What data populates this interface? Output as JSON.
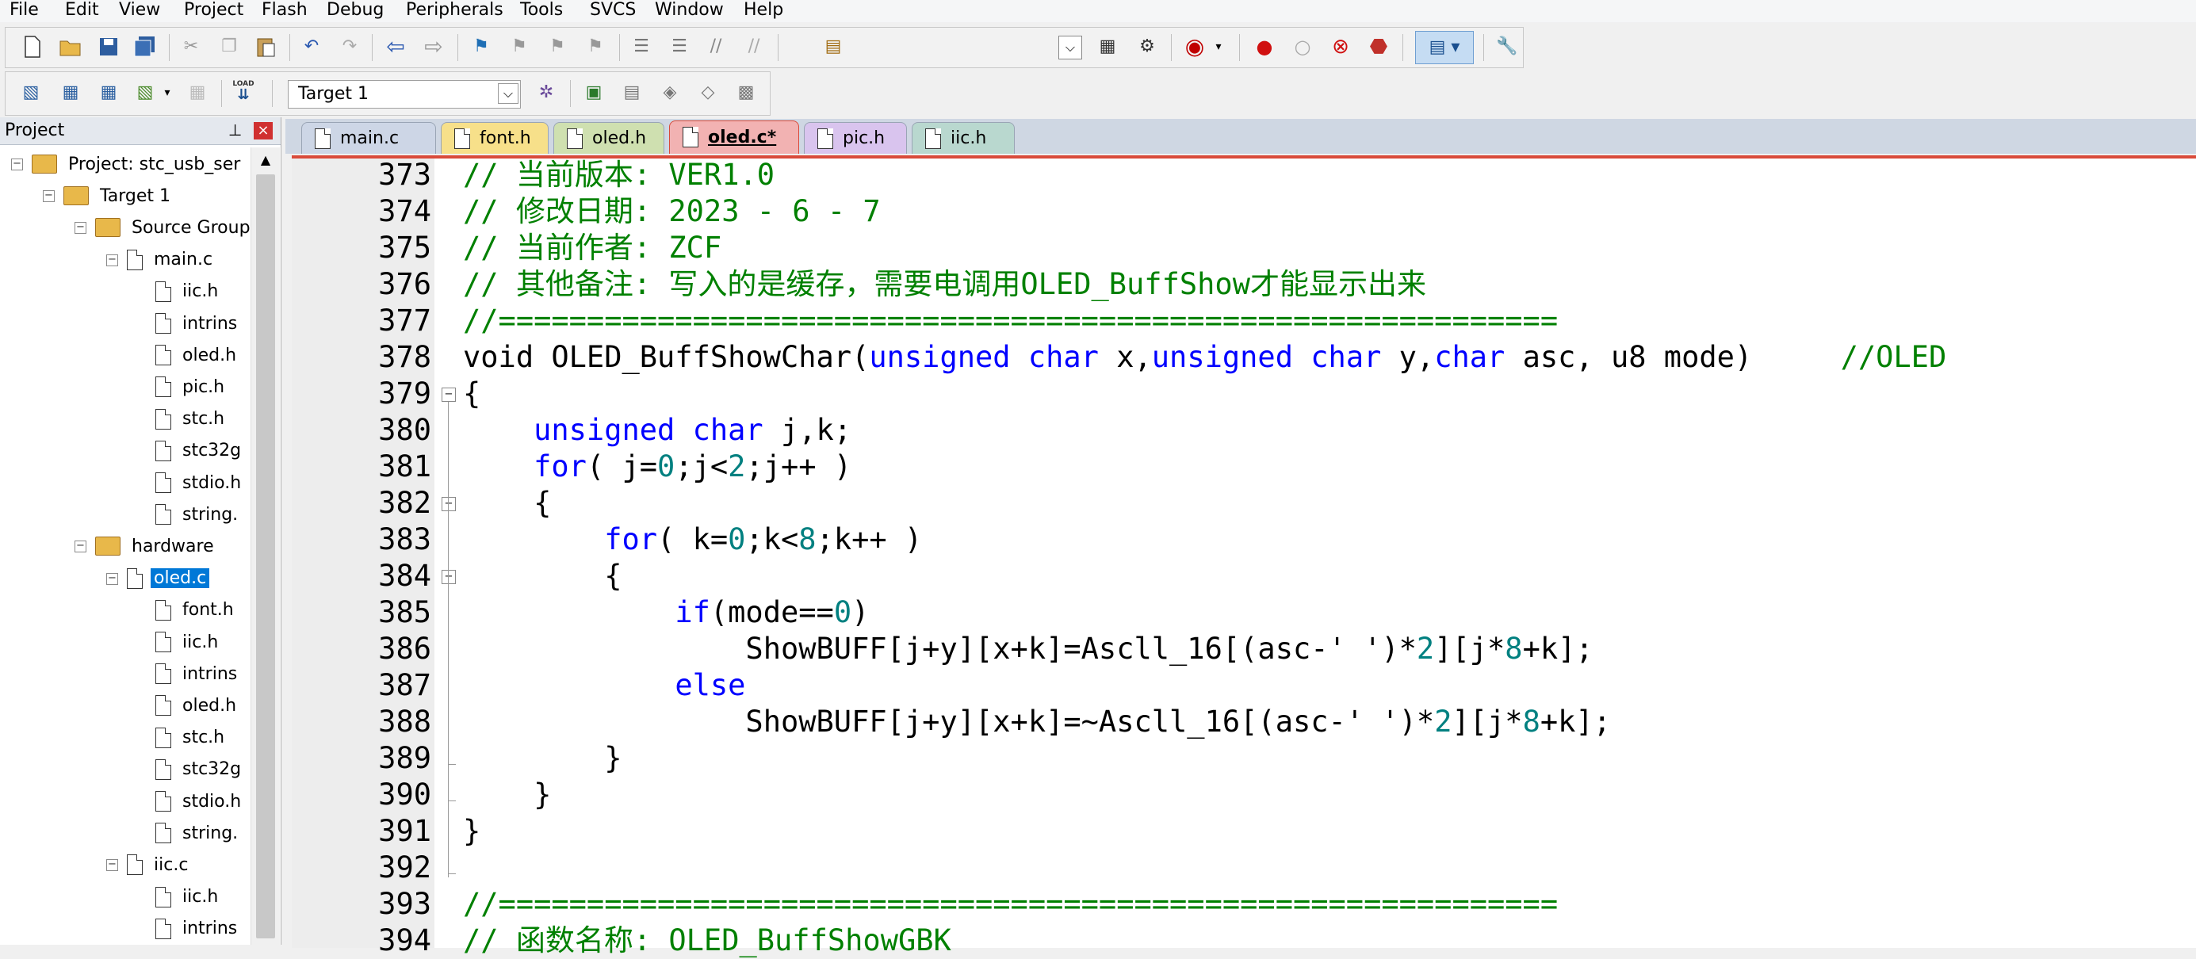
{
  "menu": [
    "File",
    "Edit",
    "View",
    "Project",
    "Flash",
    "Debug",
    "Peripherals",
    "Tools",
    "SVCS",
    "Window",
    "Help"
  ],
  "toolbar": {
    "icons": [
      "new-file-icon",
      "open-icon",
      "save-icon",
      "save-all-icon",
      "cut-icon",
      "copy-icon",
      "paste-icon",
      "undo-icon",
      "redo-icon",
      "nav-back-icon",
      "nav-forward-icon",
      "bookmark-icon",
      "prev-bookmark-icon",
      "next-bookmark-icon",
      "clear-bookmarks-icon",
      "indent-icon",
      "unindent-icon",
      "comment-icon",
      "uncomment-icon",
      "find-in-files-icon",
      "find-icon",
      "incremental-find-icon",
      "debug-session-icon",
      "breakpoint-icon",
      "disable-breakpoint-icon",
      "kill-breakpoints-icon",
      "clear-breakpoints-icon",
      "window-layout-icon",
      "configure-icon"
    ]
  },
  "build_toolbar": {
    "target": "Target 1",
    "load_label": "LOAD"
  },
  "project_panel": {
    "title": "Project",
    "pin": "ᵖ",
    "close": "×",
    "tree": [
      {
        "label": "Project: stc_usb_ser",
        "level": 0,
        "type": "project"
      },
      {
        "label": "Target 1",
        "level": 1,
        "type": "folder"
      },
      {
        "label": "Source Group",
        "level": 2,
        "type": "folder"
      },
      {
        "label": "main.c",
        "level": 3,
        "type": "file"
      },
      {
        "label": "iic.h",
        "level": 4,
        "type": "file"
      },
      {
        "label": "intrins",
        "level": 4,
        "type": "file"
      },
      {
        "label": "oled.h",
        "level": 4,
        "type": "file"
      },
      {
        "label": "pic.h",
        "level": 4,
        "type": "file"
      },
      {
        "label": "stc.h",
        "level": 4,
        "type": "file"
      },
      {
        "label": "stc32g",
        "level": 4,
        "type": "file"
      },
      {
        "label": "stdio.h",
        "level": 4,
        "type": "file"
      },
      {
        "label": "string.",
        "level": 4,
        "type": "file"
      },
      {
        "label": "hardware",
        "level": 2,
        "type": "folder"
      },
      {
        "label": "oled.c",
        "level": 3,
        "type": "file",
        "selected": true
      },
      {
        "label": "font.h",
        "level": 4,
        "type": "file"
      },
      {
        "label": "iic.h",
        "level": 4,
        "type": "file"
      },
      {
        "label": "intrins",
        "level": 4,
        "type": "file"
      },
      {
        "label": "oled.h",
        "level": 4,
        "type": "file"
      },
      {
        "label": "stc.h",
        "level": 4,
        "type": "file"
      },
      {
        "label": "stc32g",
        "level": 4,
        "type": "file"
      },
      {
        "label": "stdio.h",
        "level": 4,
        "type": "file"
      },
      {
        "label": "string.",
        "level": 4,
        "type": "file"
      },
      {
        "label": "iic.c",
        "level": 3,
        "type": "file"
      },
      {
        "label": "iic.h",
        "level": 4,
        "type": "file"
      },
      {
        "label": "intrins",
        "level": 4,
        "type": "file"
      }
    ]
  },
  "tabs": [
    {
      "label": "main.c",
      "color": "#cdd6e6",
      "active": false
    },
    {
      "label": "font.h",
      "color": "#f7e08a",
      "active": false
    },
    {
      "label": "oled.h",
      "color": "#cfe0b0",
      "active": false
    },
    {
      "label": "oled.c*",
      "color": "#f2b2b2",
      "active": true
    },
    {
      "label": "pic.h",
      "color": "#d9c4ee",
      "active": false
    },
    {
      "label": "iic.h",
      "color": "#b9d8cf",
      "active": false
    }
  ],
  "editor": {
    "lines": [
      {
        "n": "373",
        "tokens": [
          [
            "c",
            "// 当前版本: VER1.0"
          ]
        ]
      },
      {
        "n": "374",
        "tokens": [
          [
            "c",
            "// 修改日期: 2023 - 6 - 7"
          ]
        ]
      },
      {
        "n": "375",
        "tokens": [
          [
            "c",
            "// 当前作者: ZCF"
          ]
        ]
      },
      {
        "n": "376",
        "tokens": [
          [
            "c",
            "// 其他备注: 写入的是缓存，需要电调用OLED_BuffShow才能显示出来"
          ]
        ]
      },
      {
        "n": "377",
        "tokens": [
          [
            "c",
            "//============================================================"
          ]
        ]
      },
      {
        "n": "378",
        "tokens": [
          [
            "t",
            "void OLED_BuffShowChar("
          ],
          [
            "k",
            "unsigned char"
          ],
          [
            "t",
            " x,"
          ],
          [
            "k",
            "unsigned char"
          ],
          [
            "t",
            " y,"
          ],
          [
            "k",
            "char"
          ],
          [
            "t",
            " asc, u8 mode)     "
          ],
          [
            "c",
            "//OLED"
          ]
        ]
      },
      {
        "n": "379",
        "tokens": [
          [
            "t",
            "{"
          ]
        ]
      },
      {
        "n": "380",
        "tokens": [
          [
            "t",
            "    "
          ],
          [
            "k",
            "unsigned char"
          ],
          [
            "t",
            " j,k;"
          ]
        ]
      },
      {
        "n": "381",
        "tokens": [
          [
            "t",
            "    "
          ],
          [
            "k",
            "for"
          ],
          [
            "t",
            "( j="
          ],
          [
            "n",
            "0"
          ],
          [
            "t",
            ";j<"
          ],
          [
            "n",
            "2"
          ],
          [
            "t",
            ";j++ )"
          ]
        ]
      },
      {
        "n": "382",
        "tokens": [
          [
            "t",
            "    {"
          ]
        ]
      },
      {
        "n": "383",
        "tokens": [
          [
            "t",
            "        "
          ],
          [
            "k",
            "for"
          ],
          [
            "t",
            "( k="
          ],
          [
            "n",
            "0"
          ],
          [
            "t",
            ";k<"
          ],
          [
            "n",
            "8"
          ],
          [
            "t",
            ";k++ )"
          ]
        ]
      },
      {
        "n": "384",
        "tokens": [
          [
            "t",
            "        {"
          ]
        ]
      },
      {
        "n": "385",
        "tokens": [
          [
            "t",
            "            "
          ],
          [
            "k",
            "if"
          ],
          [
            "t",
            "(mode=="
          ],
          [
            "n",
            "0"
          ],
          [
            "t",
            ")"
          ]
        ]
      },
      {
        "n": "386",
        "tokens": [
          [
            "t",
            "                ShowBUFF[j+y][x+k]=Ascll_16[(asc-' ')*"
          ],
          [
            "n",
            "2"
          ],
          [
            "t",
            "][j*"
          ],
          [
            "n",
            "8"
          ],
          [
            "t",
            "+k];"
          ]
        ]
      },
      {
        "n": "387",
        "tokens": [
          [
            "t",
            "            "
          ],
          [
            "k",
            "else"
          ]
        ]
      },
      {
        "n": "388",
        "tokens": [
          [
            "t",
            "                ShowBUFF[j+y][x+k]=~Ascll_16[(asc-' ')*"
          ],
          [
            "n",
            "2"
          ],
          [
            "t",
            "][j*"
          ],
          [
            "n",
            "8"
          ],
          [
            "t",
            "+k];"
          ]
        ]
      },
      {
        "n": "389",
        "tokens": [
          [
            "t",
            "        }"
          ]
        ]
      },
      {
        "n": "390",
        "tokens": [
          [
            "t",
            "    }"
          ]
        ]
      },
      {
        "n": "391",
        "tokens": [
          [
            "t",
            "}"
          ]
        ]
      },
      {
        "n": "392",
        "tokens": [
          [
            "t",
            ""
          ]
        ]
      },
      {
        "n": "393",
        "tokens": [
          [
            "c",
            "//============================================================"
          ]
        ]
      },
      {
        "n": "394",
        "tokens": [
          [
            "c",
            "// 函数名称: OLED_BuffShowGBK"
          ]
        ]
      }
    ]
  },
  "colors": {
    "comment": "#008000",
    "keyword": "#0000ff",
    "number": "#008080",
    "active_tab_border": "#d94a3a",
    "selection": "#0078d7"
  }
}
